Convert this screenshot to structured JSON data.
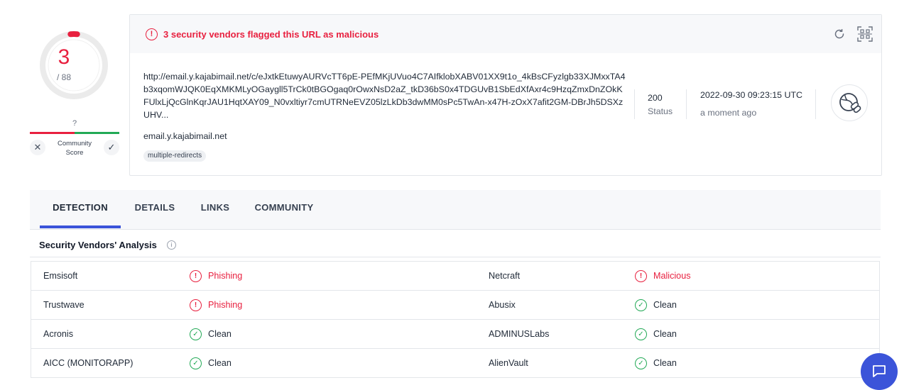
{
  "score": {
    "detections": "3",
    "total": "/ 88",
    "community_value": "?",
    "community_label_line1": "Community",
    "community_label_line2": "Score",
    "down_glyph": "✕",
    "up_glyph": "✓",
    "colors": {
      "malicious": "#e8203f",
      "harmless": "#22a956",
      "gauge_track": "#ebebeb"
    }
  },
  "summary": {
    "alert_text": "3 security vendors flagged this URL as malicious",
    "url": "http://email.y.kajabimail.net/c/eJxtkEtuwyAURVcTT6pE-PEfMKjUVuo4C7AIfklobXABV01XX9t1o_4kBsCFyzlgb33XJMxxTA4b3xqomWJQK0EqXMKMLyOGaygll5TrCk0tBGOgaq0rOwxNsD2aZ_tkD36bS0x4TDGUvB1SbEdXfAxr4c9HzqZmxDnZOkKFUlxLjQcGlnKqrJAU1HqtXAY09_N0vxltiyr7cmUTRNeEVZ05lzLkDb3dwMM0sPc5TwAn-x47H-zOxX7afit2GM-DBrJh5DSXzUHV...",
    "domain": "email.y.kajabimail.net",
    "tags": [
      "multiple-redirects"
    ],
    "status_code": "200",
    "status_label": "Status",
    "date": "2022-09-30 09:23:15 UTC",
    "relative_time": "a moment ago"
  },
  "tabs": [
    {
      "label": "DETECTION",
      "active": true
    },
    {
      "label": "DETAILS",
      "active": false
    },
    {
      "label": "LINKS",
      "active": false
    },
    {
      "label": "COMMUNITY",
      "active": false
    }
  ],
  "section": {
    "title": "Security Vendors' Analysis"
  },
  "vendors": [
    {
      "left": {
        "name": "Emsisoft",
        "result": "Phishing",
        "status": "bad"
      },
      "right": {
        "name": "Netcraft",
        "result": "Malicious",
        "status": "bad"
      }
    },
    {
      "left": {
        "name": "Trustwave",
        "result": "Phishing",
        "status": "bad"
      },
      "right": {
        "name": "Abusix",
        "result": "Clean",
        "status": "good"
      }
    },
    {
      "left": {
        "name": "Acronis",
        "result": "Clean",
        "status": "good"
      },
      "right": {
        "name": "ADMINUSLabs",
        "result": "Clean",
        "status": "good"
      }
    },
    {
      "left": {
        "name": "AICC (MONITORAPP)",
        "result": "Clean",
        "status": "good"
      },
      "right": {
        "name": "AlienVault",
        "result": "Clean",
        "status": "good"
      }
    }
  ],
  "icons": {
    "alert": "exclamation-circle-icon",
    "refresh": "refresh-icon",
    "qr": "qr-scan-icon",
    "link": "link-icon",
    "info": "info-icon",
    "chat": "chat-bubble-icon",
    "clean": "check-circle-icon",
    "detected": "exclamation-circle-icon"
  }
}
